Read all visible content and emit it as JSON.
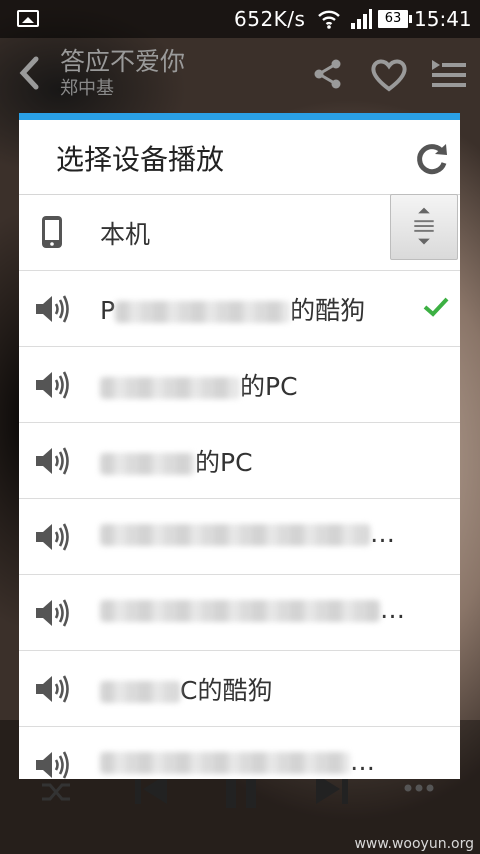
{
  "status_bar": {
    "net_speed": "652K/s",
    "battery": "63",
    "time": "15:41"
  },
  "player": {
    "song_title": "答应不爱你",
    "artist": "郑中基"
  },
  "dialog": {
    "title": "选择设备播放",
    "devices": [
      {
        "label": "本机",
        "icon": "phone-icon",
        "selected": false
      },
      {
        "label": "P▒▒▒▒▒的酷狗",
        "prefix": "P",
        "suffix": "的酷狗",
        "icon": "speaker-icon",
        "selected": true
      },
      {
        "label": "▒▒▒的PC",
        "prefix": "",
        "suffix": "的PC",
        "icon": "speaker-icon",
        "selected": false
      },
      {
        "label": "▒▒的PC",
        "prefix": "",
        "suffix": "的PC",
        "icon": "speaker-icon",
        "selected": false
      },
      {
        "label": "▒▒▒▒▒…",
        "prefix": "",
        "suffix": "…",
        "icon": "speaker-icon",
        "selected": false
      },
      {
        "label": "▒▒▒▒▒…",
        "prefix": "",
        "suffix": "…",
        "icon": "speaker-icon",
        "selected": false
      },
      {
        "label": "▒▒C的酷狗",
        "prefix": "",
        "suffix": "C的酷狗",
        "icon": "speaker-icon",
        "selected": false
      },
      {
        "label": "▒▒▒▒▒…",
        "prefix": "",
        "suffix": "…",
        "icon": "speaker-icon",
        "selected": false
      }
    ]
  },
  "watermark": "www.wooyun.org",
  "colors": {
    "accent": "#2aa0e6",
    "check": "#3cb043"
  }
}
